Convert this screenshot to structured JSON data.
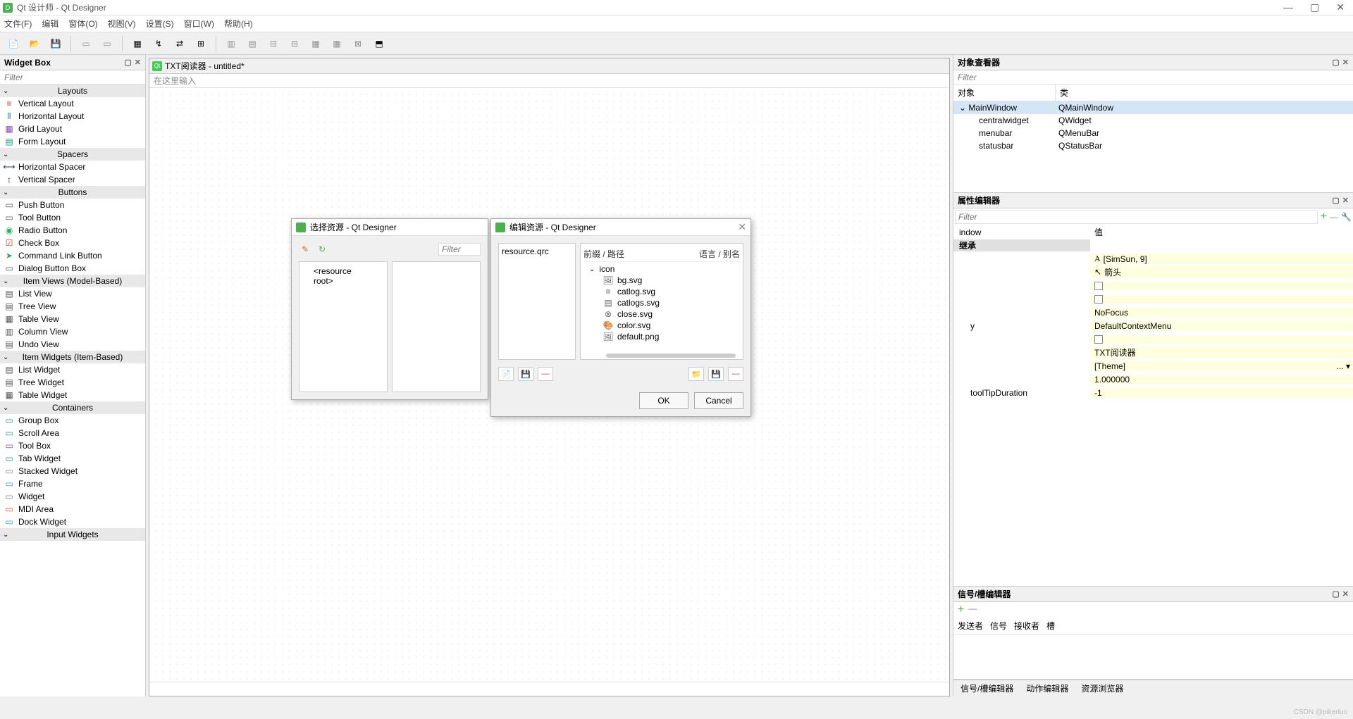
{
  "app": {
    "title": "Qt 设计师 - Qt Designer",
    "icon_letter": "D"
  },
  "menubar": [
    "文件(F)",
    "编辑",
    "窗体(O)",
    "视图(V)",
    "设置(S)",
    "窗口(W)",
    "帮助(H)"
  ],
  "widget_box": {
    "title": "Widget Box",
    "filter_placeholder": "Filter",
    "groups": [
      {
        "name": "Layouts",
        "items": [
          "Vertical Layout",
          "Horizontal Layout",
          "Grid Layout",
          "Form Layout"
        ]
      },
      {
        "name": "Spacers",
        "items": [
          "Horizontal Spacer",
          "Vertical Spacer"
        ]
      },
      {
        "name": "Buttons",
        "items": [
          "Push Button",
          "Tool Button",
          "Radio Button",
          "Check Box",
          "Command Link Button",
          "Dialog Button Box"
        ]
      },
      {
        "name": "Item Views (Model-Based)",
        "items": [
          "List View",
          "Tree View",
          "Table View",
          "Column View",
          "Undo View"
        ]
      },
      {
        "name": "Item Widgets (Item-Based)",
        "items": [
          "List Widget",
          "Tree Widget",
          "Table Widget"
        ]
      },
      {
        "name": "Containers",
        "items": [
          "Group Box",
          "Scroll Area",
          "Tool Box",
          "Tab Widget",
          "Stacked Widget",
          "Frame",
          "Widget",
          "MDI Area",
          "Dock Widget"
        ]
      },
      {
        "name": "Input Widgets",
        "items": []
      }
    ]
  },
  "form": {
    "title": "TXT阅读器 - untitled*",
    "menu_hint": "在这里输入"
  },
  "object_inspector": {
    "title": "对象查看器",
    "filter_placeholder": "Filter",
    "cols": [
      "对象",
      "类"
    ],
    "rows": [
      {
        "name": "MainWindow",
        "class": "QMainWindow",
        "indent": 0,
        "selected": true,
        "expand": true
      },
      {
        "name": "centralwidget",
        "class": "QWidget",
        "indent": 1
      },
      {
        "name": "menubar",
        "class": "QMenuBar",
        "indent": 1
      },
      {
        "name": "statusbar",
        "class": "QStatusBar",
        "indent": 1
      }
    ]
  },
  "property_editor": {
    "title": "属性编辑器",
    "filter_placeholder": "Filter",
    "cols": [
      "",
      "值"
    ],
    "object_row": "indow",
    "section": "继承",
    "rows": [
      {
        "name": "",
        "value": "[SimSun, 9]",
        "icon": "A"
      },
      {
        "name": "",
        "value": "箭头",
        "icon": "↖"
      },
      {
        "name": "",
        "value": "",
        "checkbox": true
      },
      {
        "name": "",
        "value": "",
        "checkbox": true
      },
      {
        "name": "",
        "value": "NoFocus"
      },
      {
        "name": "y",
        "value": "DefaultContextMenu"
      },
      {
        "name": "",
        "value": "",
        "checkbox": true
      },
      {
        "name": "",
        "value": "TXT阅读器"
      },
      {
        "name": "",
        "value": "[Theme]",
        "selected": true,
        "combo": true
      },
      {
        "name": "",
        "value": "1.000000"
      },
      {
        "name": "toolTipDuration",
        "value": "-1"
      }
    ]
  },
  "signal_editor": {
    "title": "信号/槽编辑器",
    "cols": [
      "发送者",
      "信号",
      "接收者",
      "槽"
    ]
  },
  "bottom_tabs": [
    "信号/槽编辑器",
    "动作编辑器",
    "资源浏览器"
  ],
  "dialog1": {
    "title": "选择资源 - Qt Designer",
    "filter": "Filter",
    "root": "<resource root>"
  },
  "dialog2": {
    "title": "编辑资源 - Qt Designer",
    "qrc": "resource.qrc",
    "col_prefix": "前缀 / 路径",
    "col_lang": "语言 / 别名",
    "tree_root": "icon",
    "files": [
      "bg.svg",
      "catlog.svg",
      "catlogs.svg",
      "close.svg",
      "color.svg",
      "default.png"
    ],
    "ok": "OK",
    "cancel": "Cancel"
  },
  "watermark": "CSDN @pikeduo"
}
